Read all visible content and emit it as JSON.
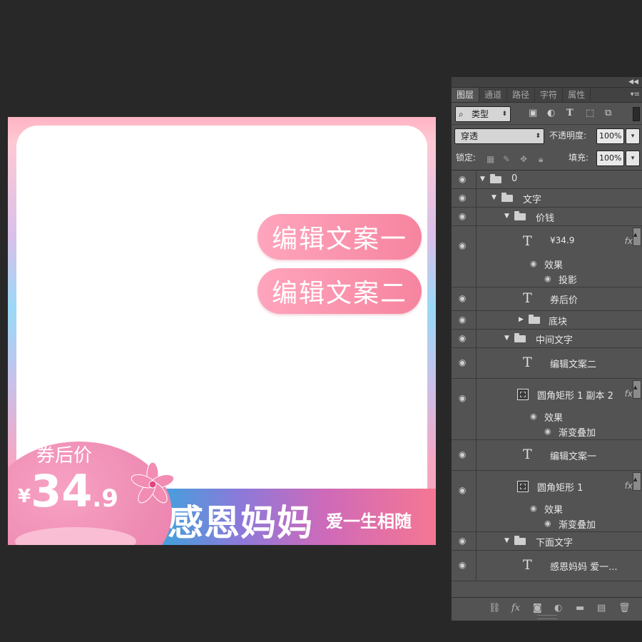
{
  "canvas": {
    "pill_1": "编辑文案一",
    "pill_2": "编辑文案二",
    "after_coupon_label": "券后价",
    "currency": "¥",
    "price_int": "34",
    "price_dec": ".9",
    "banner_title": "感恩妈妈",
    "banner_subtitle": "爱一生相随"
  },
  "panel": {
    "tabs": [
      "图层",
      "通道",
      "路径",
      "字符",
      "属性"
    ],
    "active_tab": "图层",
    "filter_type": "类型",
    "blend_mode": "穿透",
    "opacity_label": "不透明度:",
    "opacity_value": "100%",
    "lock_label": "锁定:",
    "fill_label": "填充:",
    "fill_value": "100%"
  },
  "layers": {
    "group_0": "0",
    "group_text": "文字",
    "group_price": "价钱",
    "layer_price": "¥34.9",
    "effects_label": "效果",
    "effect_drop_shadow": "投影",
    "layer_after_coupon": "券后价",
    "group_base": "底块",
    "group_middle_text": "中间文字",
    "layer_edit_2": "编辑文案二",
    "layer_rect_copy": "圆角矩形 1 副本 2",
    "effect_gradient": "渐变叠加",
    "layer_edit_1": "编辑文案一",
    "layer_rect": "圆角矩形 1",
    "group_bottom_text": "下面文字",
    "layer_bottom": "感恩妈妈 爱一..."
  },
  "colors": {
    "workspace_bg": "#282828",
    "panel_bg": "#535353",
    "pill_gradient": [
      "#ffa5bd",
      "#f6849f"
    ],
    "banner_gradient": [
      "#35a8dd",
      "#8c79d9",
      "#cf6ab9",
      "#f57792"
    ],
    "price_blob": "#ee8bb3"
  },
  "icons": {
    "visibility": "eye-icon",
    "text_layer": "text-layer-icon",
    "shape_layer": "rounded-rectangle-icon",
    "group": "folder-icon",
    "effects": "fx-icon"
  }
}
